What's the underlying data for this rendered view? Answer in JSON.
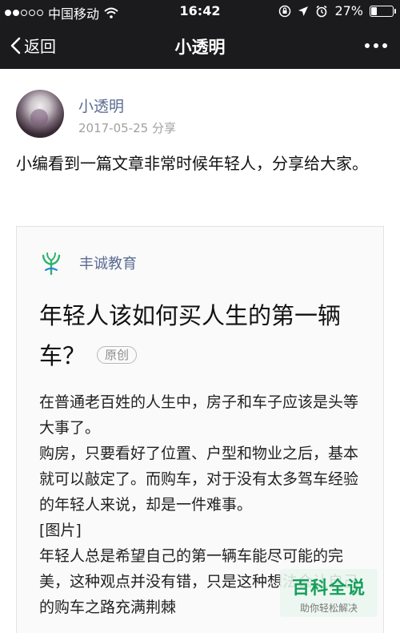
{
  "status_bar": {
    "carrier": "中国移动",
    "time": "16:42",
    "battery_level": "27%",
    "battery_fraction": 0.27,
    "icons": [
      "signal-dots-icon",
      "wifi-icon",
      "rotation-lock-icon",
      "location-arrow-icon",
      "alarm-icon",
      "battery-icon"
    ]
  },
  "nav": {
    "back_label": "返回",
    "title": "小透明",
    "more_icon": "more-dots-icon"
  },
  "post": {
    "author_name": "小透明",
    "date": "2017-05-25",
    "shared_label": "分享",
    "text": "小编看到一篇文章非常时候年轻人，分享给大家。"
  },
  "card": {
    "source_name": "丰诚教育",
    "source_icon": "sprout-logo-icon",
    "title": "年轻人该如何买人生的第一辆车？",
    "original_badge": "原创",
    "excerpt": [
      "在普通老百姓的人生中，房子和车子应该是头等大事了。",
      "购房，只要看好了位置、户型和物业之后，基本就可以敲定了。而购车，对于没有太多驾车经验的年轻人来说，却是一件难事。",
      "[图片]",
      "年轻人总是希望自己的第一辆车能尽可能的完美，这种观点并没有错，只是这种想法会让自己的购车之路充满荆棘"
    ]
  },
  "watermark": {
    "title": "百科全说",
    "subtitle": "助你轻松解决"
  },
  "colors": {
    "bar_background": "#1b1b1d",
    "link_blue": "#5a6c92",
    "meta_gray": "#a0a0a0",
    "logo_green": "#2fb36b",
    "watermark_green": "#14a05a"
  }
}
